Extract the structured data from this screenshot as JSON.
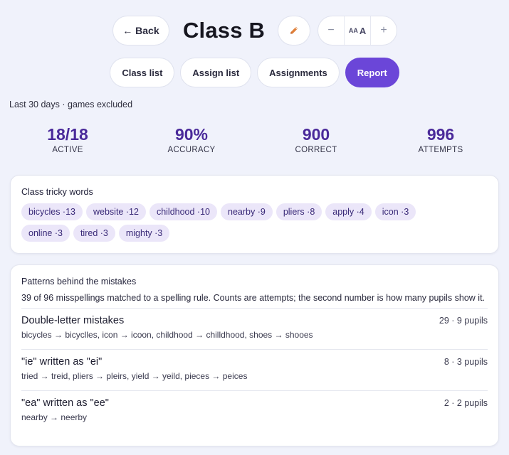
{
  "header": {
    "back_label": "← Back",
    "title": "Class B",
    "font_small_glyph": "AA",
    "font_big_glyph": "A",
    "minus": "−",
    "plus": "+"
  },
  "tabs": [
    {
      "label": "Class list",
      "active": false
    },
    {
      "label": "Assign list",
      "active": false
    },
    {
      "label": "Assignments",
      "active": false
    },
    {
      "label": "Report",
      "active": true
    }
  ],
  "period": "Last 30 days · games excluded",
  "stats": [
    {
      "value": "18/18",
      "label": "ACTIVE"
    },
    {
      "value": "90%",
      "label": "ACCURACY"
    },
    {
      "value": "900",
      "label": "CORRECT"
    },
    {
      "value": "996",
      "label": "ATTEMPTS"
    }
  ],
  "tricky": {
    "heading": "Class tricky words",
    "words": [
      "bicycles ·13",
      "website ·12",
      "childhood ·10",
      "nearby ·9",
      "pliers ·8",
      "apply ·4",
      "icon ·3",
      "online ·3",
      "tired ·3",
      "mighty ·3"
    ]
  },
  "patterns": {
    "heading": "Patterns behind the mistakes",
    "description": "39 of 96 misspellings matched to a spelling rule. Counts are attempts; the second number is how many pupils show it.",
    "items": [
      {
        "title": "Double-letter mistakes",
        "count": "29 · 9 pupils",
        "examples": "bicycles → bicyclles, icon → icoon, childhood → chilldhood, shoes → shooes"
      },
      {
        "title": "\"ie\" written as \"ei\"",
        "count": "8 · 3 pupils",
        "examples": "tried → treid, pliers → pleirs, yield → yeild, pieces → peices"
      },
      {
        "title": "\"ea\" written as \"ee\"",
        "count": "2 · 2 pupils",
        "examples": "nearby → neerby"
      }
    ]
  },
  "colors": {
    "accent": "#6b46d8",
    "stat_number": "#4a2a9a",
    "chip_bg": "#ebe6f9",
    "pencil": "#e0803a"
  },
  "icons": {
    "edit": "pencil-icon"
  }
}
